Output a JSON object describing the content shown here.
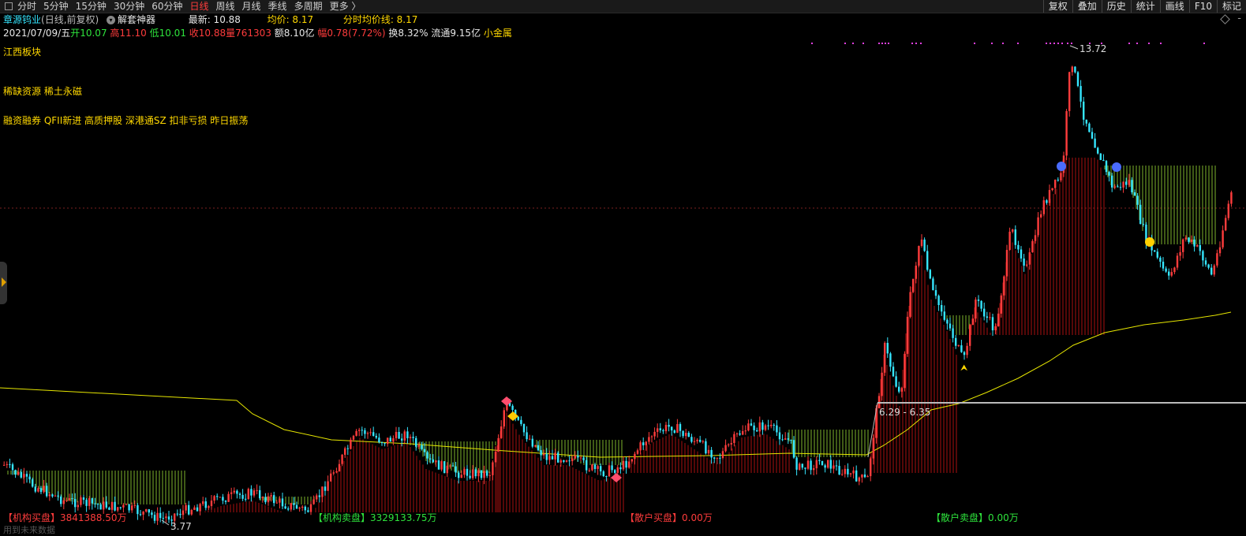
{
  "toolbar": {
    "periods": [
      "分时",
      "5分钟",
      "15分钟",
      "30分钟",
      "60分钟",
      "日线",
      "周线",
      "月线",
      "季线",
      "多周期",
      "更多 〉"
    ],
    "active_period": "日线",
    "tools": [
      "复权",
      "叠加",
      "历史",
      "统计",
      "画线",
      "F10",
      "标记"
    ]
  },
  "stock": {
    "name": "章源钨业",
    "mode": "(日线,前复权)",
    "jietao_icon": "▾",
    "jietao": "解套神器",
    "latest_label": "最新: 10.88",
    "avg_label": "均价: 8.17",
    "intraday_avg_label": "分时均价线: 8.17"
  },
  "ohlc": {
    "date": "2021/07/09/五",
    "open": "开10.07",
    "high": "高11.10",
    "low": "低10.01",
    "close": "收10.88",
    "volume": "量761303",
    "amount": "额8.10亿",
    "change": "幅0.78(7.72%)",
    "turnover": "换8.32%",
    "float": "流通9.15亿",
    "size": "小金属"
  },
  "tags": {
    "sector": "江西板块",
    "concepts": "稀缺资源 稀土永磁",
    "features": "融资融券 QFII新进 高质押股 深港通SZ 扣非亏损 昨日振荡"
  },
  "annotations": {
    "high_label": "13.72",
    "low_label": "3.77",
    "range_label": "6.29 - 6.35"
  },
  "bottom": {
    "inst_buy": "【机构买盘】3841388.50万",
    "inst_sell": "【机构卖盘】3329133.75万",
    "retail_buy": "【散户买盘】0.00万",
    "retail_sell": "【散户卖盘】0.00万",
    "footnote": "用到未来数据"
  },
  "colors": {
    "up": "#ff3c3c",
    "down": "#35e6ff",
    "ma": "#e6e600",
    "inst_bar": "#c81414",
    "retail_bar": "#8cc832"
  }
}
